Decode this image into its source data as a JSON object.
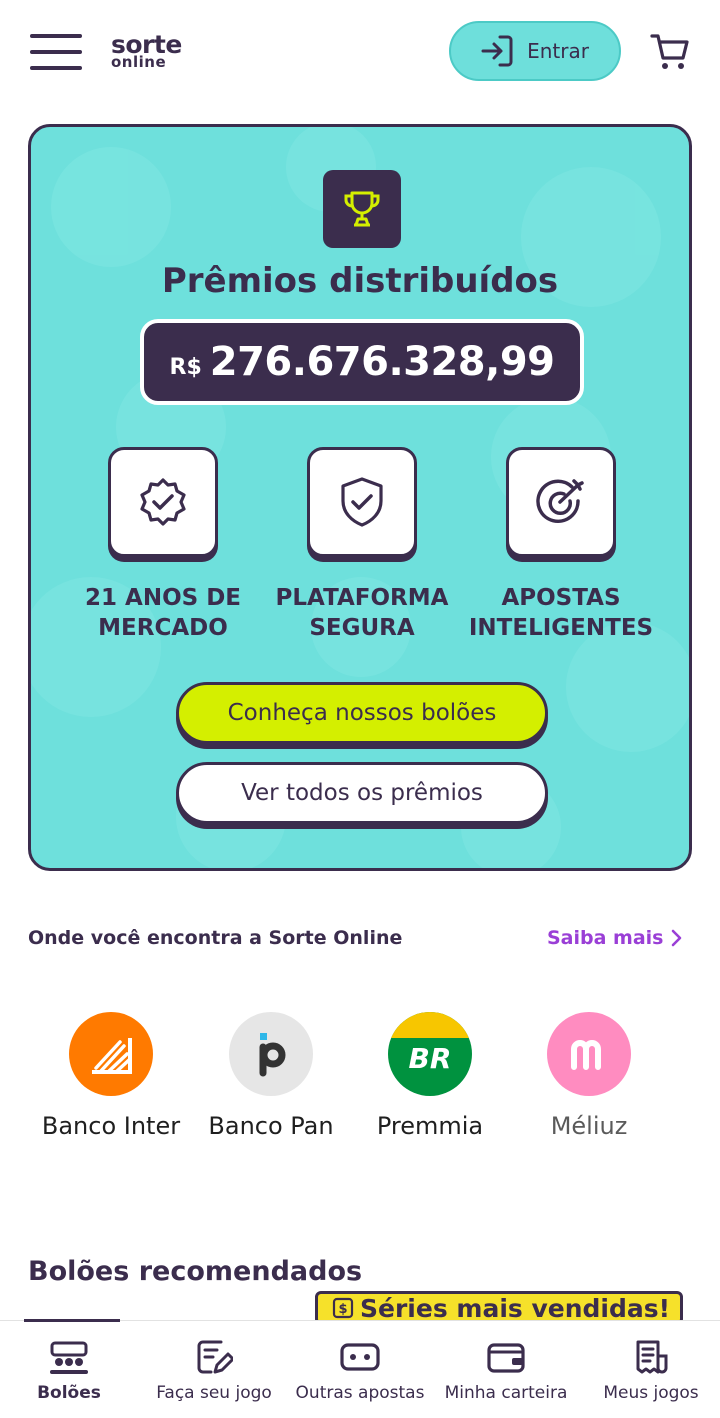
{
  "header": {
    "logo_line1": "sorte",
    "logo_line2": "online",
    "login_label": "Entrar"
  },
  "hero": {
    "title": "Prêmios distribuídos",
    "currency": "R$",
    "amount": "276.676.328,99",
    "features": [
      {
        "line1": "21 ANOS DE",
        "line2": "MERCADO",
        "icon": "badge-check-icon"
      },
      {
        "line1": "PLATAFORMA",
        "line2": "SEGURA",
        "icon": "shield-check-icon"
      },
      {
        "line1": "APOSTAS",
        "line2": "INTELIGENTES",
        "icon": "target-arrow-icon"
      }
    ],
    "primary_button": "Conheça nossos bolões",
    "secondary_button": "Ver todos os prêmios"
  },
  "partners_section": {
    "title": "Onde você encontra a Sorte Online",
    "learn_more": "Saiba mais",
    "partners": [
      {
        "name": "Banco Inter",
        "color": "#ff7a00"
      },
      {
        "name": "Banco Pan",
        "color": "#e6e6e6"
      },
      {
        "name": "Premmia",
        "color": "#00923f"
      },
      {
        "name": "Méliuz",
        "color": "#ff79b4"
      }
    ]
  },
  "recommended": {
    "title": "Bolões recomendados",
    "badge": "Séries mais vendidas!"
  },
  "bottom_nav": [
    {
      "label": "Bolões",
      "active": true
    },
    {
      "label": "Faça seu jogo",
      "active": false
    },
    {
      "label": "Outras apostas",
      "active": false
    },
    {
      "label": "Minha carteira",
      "active": false
    },
    {
      "label": "Meus jogos",
      "active": false
    }
  ],
  "colors": {
    "brand_dark": "#3b2d4d",
    "brand_teal": "#6ee0dc",
    "brand_lime": "#d4ef00",
    "accent_purple": "#9a3fd6",
    "badge_yellow": "#f6e12a"
  }
}
